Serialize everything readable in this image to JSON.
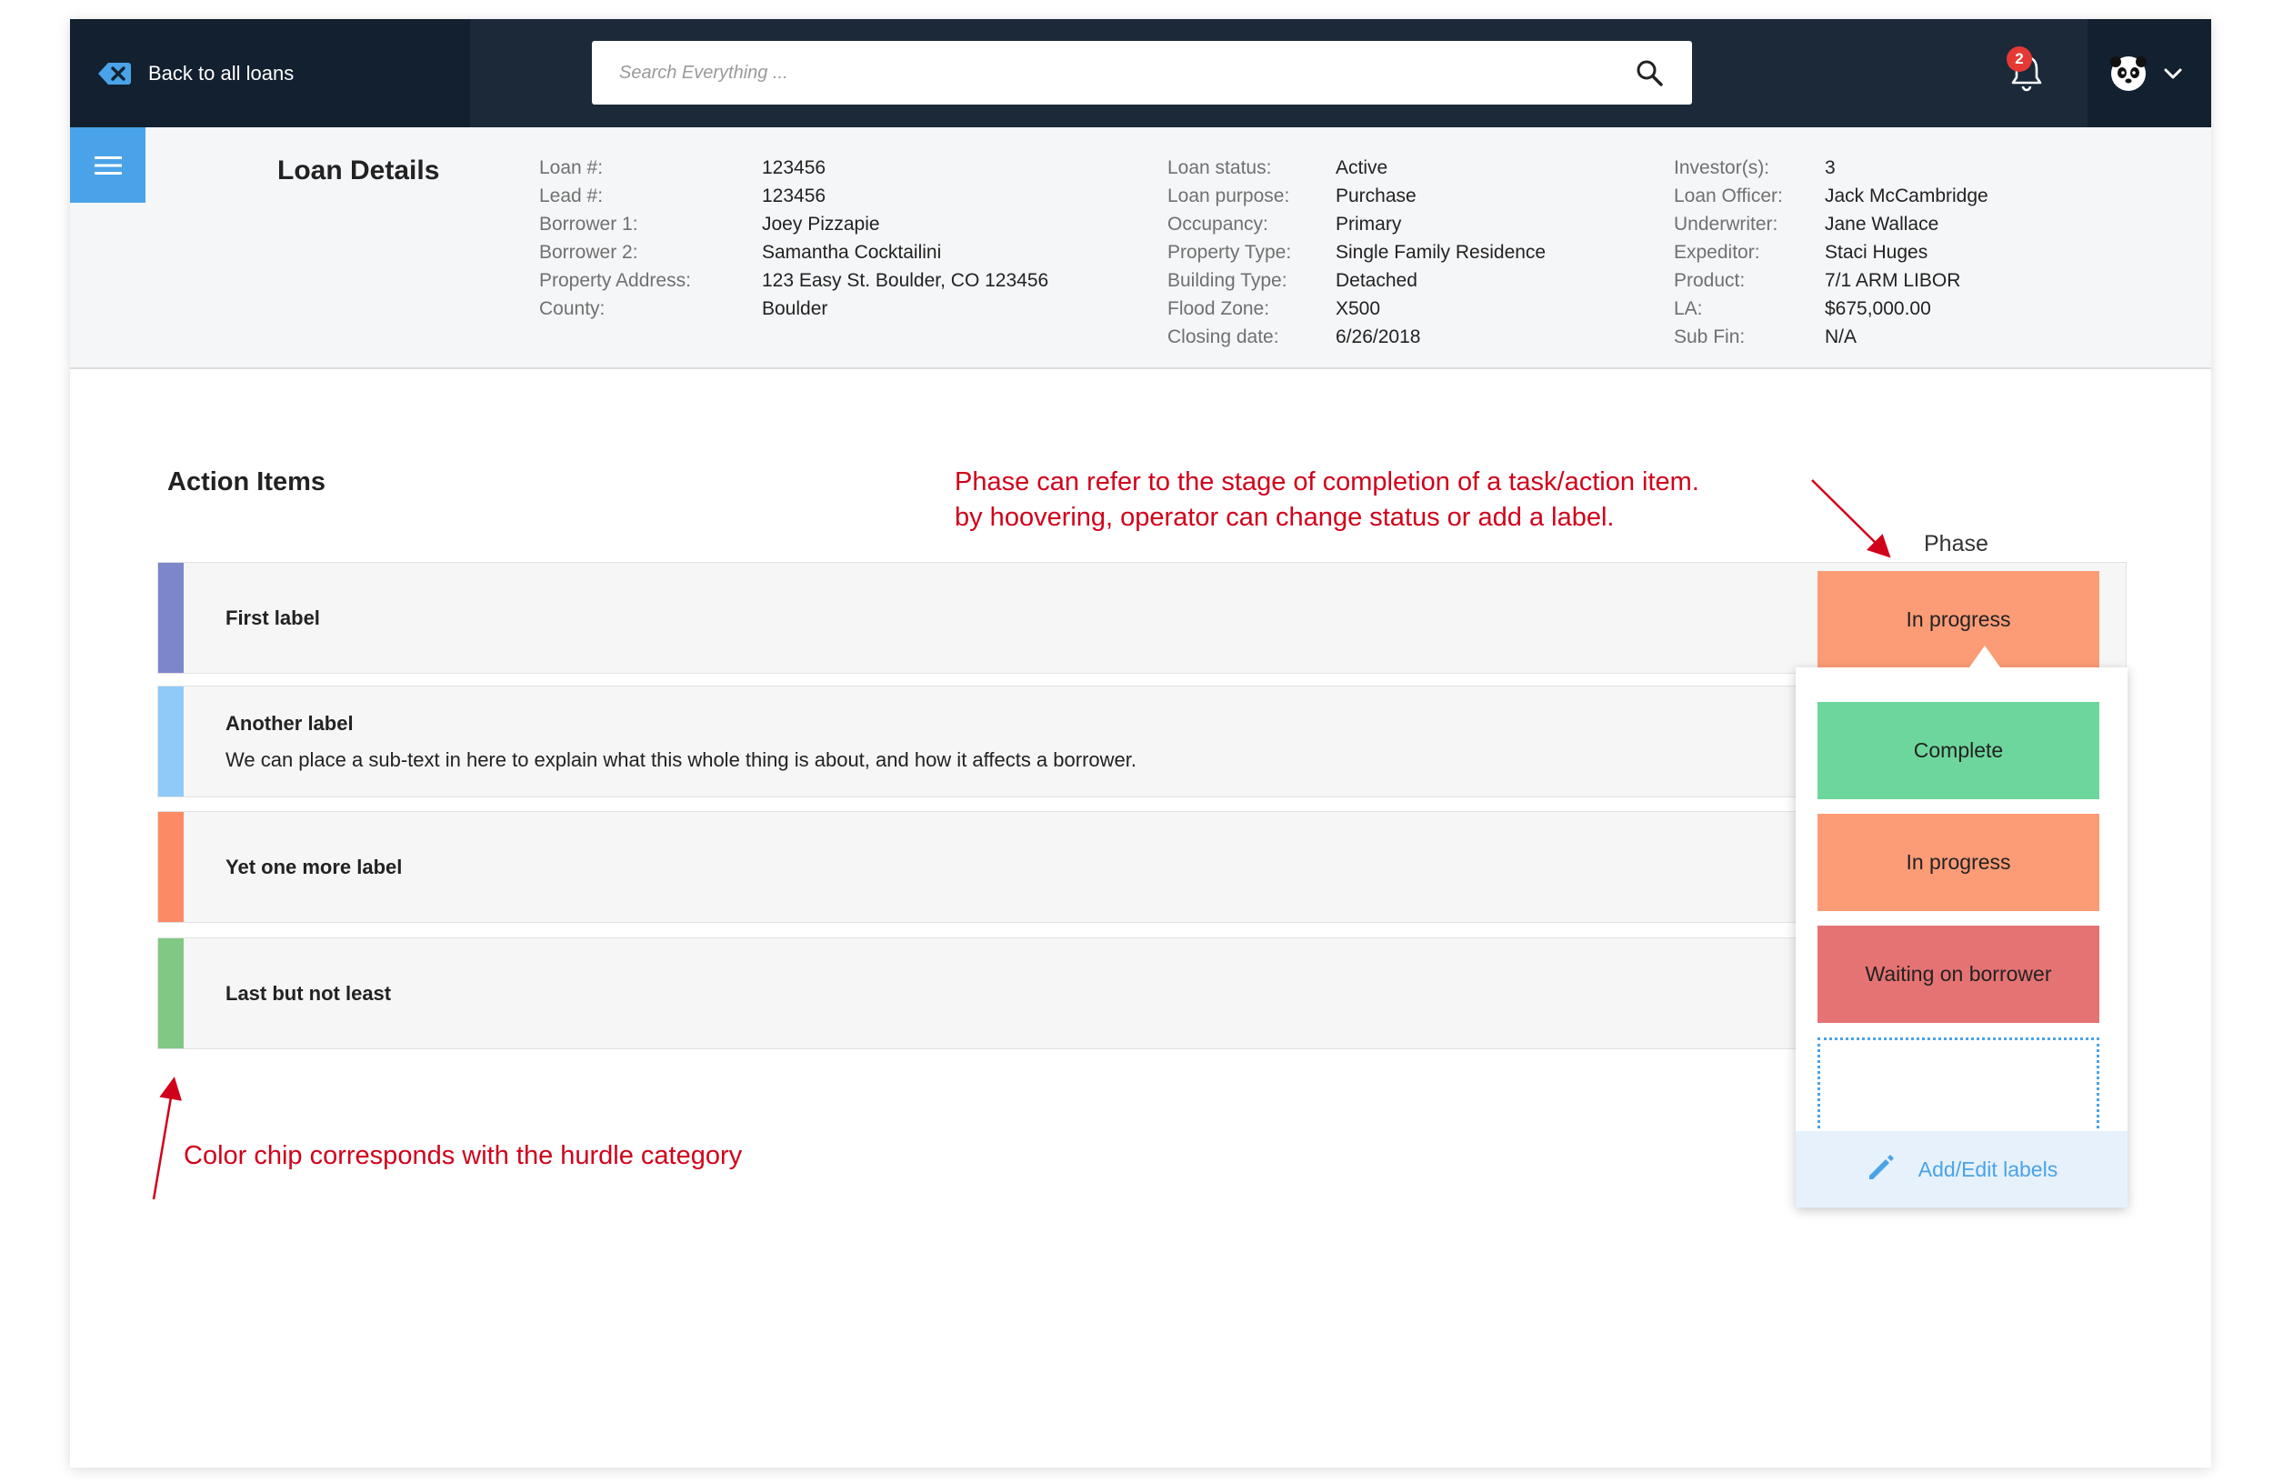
{
  "topbar": {
    "back_label": "Back to all loans",
    "search_placeholder": "Search Everything ...",
    "notification_count": "2"
  },
  "loan": {
    "title": "Loan Details",
    "col1": [
      {
        "k": "Loan #:",
        "v": "123456"
      },
      {
        "k": "Lead #:",
        "v": "123456"
      },
      {
        "k": "Borrower 1:",
        "v": "Joey Pizzapie"
      },
      {
        "k": "Borrower 2:",
        "v": "Samantha Cocktailini"
      },
      {
        "k": "Property Address:",
        "v": "123 Easy St. Boulder, CO 123456"
      },
      {
        "k": "County:",
        "v": "Boulder"
      }
    ],
    "col2": [
      {
        "k": "Loan status:",
        "v": "Active"
      },
      {
        "k": "Loan purpose:",
        "v": "Purchase"
      },
      {
        "k": "Occupancy:",
        "v": "Primary"
      },
      {
        "k": "Property Type:",
        "v": "Single Family Residence"
      },
      {
        "k": "Building Type:",
        "v": "Detached"
      },
      {
        "k": "Flood Zone:",
        "v": "X500"
      },
      {
        "k": "Closing date:",
        "v": "6/26/2018"
      }
    ],
    "col3": [
      {
        "k": "Investor(s):",
        "v": "3"
      },
      {
        "k": "Loan Officer:",
        "v": "Jack McCambridge"
      },
      {
        "k": "Underwriter:",
        "v": "Jane Wallace"
      },
      {
        "k": "Expeditor:",
        "v": "Staci Huges"
      },
      {
        "k": "Product:",
        "v": "7/1 ARM LIBOR"
      },
      {
        "k": "LA:",
        "v": "$675,000.00"
      },
      {
        "k": "Sub Fin:",
        "v": "N/A"
      }
    ]
  },
  "actions": {
    "title": "Action Items",
    "phase_header": "Phase",
    "items": [
      {
        "title": "First label",
        "sub": "",
        "color": "#7b86cb"
      },
      {
        "title": "Another label",
        "sub": "We can place a sub-text in here to explain what this whole thing is about, and how it affects a borrower.",
        "color": "#90caf9"
      },
      {
        "title": "Yet one more label",
        "sub": "",
        "color": "#fc8a65"
      },
      {
        "title": "Last but not least",
        "sub": "",
        "color": "#80c883"
      }
    ],
    "current_phase": "In progress"
  },
  "dropdown": {
    "options": [
      {
        "label": "Complete",
        "color": "#6dd69c"
      },
      {
        "label": "In progress",
        "color": "#fc9c77"
      },
      {
        "label": "Waiting on borrower",
        "color": "#e57373"
      },
      {
        "label": "",
        "color": ""
      }
    ],
    "edit_label": "Add/Edit labels"
  },
  "annotations": {
    "top_line1": "Phase can refer to the stage of completion of a task/action item.",
    "top_line2": "by hoovering, operator can change status or add a label.",
    "bottom": "Color chip corresponds with the hurdle category"
  }
}
